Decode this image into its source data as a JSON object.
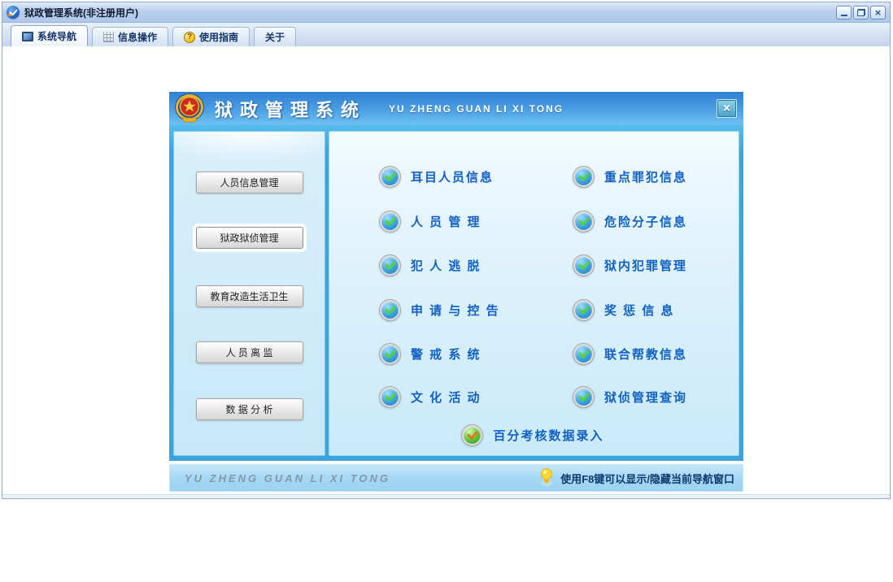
{
  "window": {
    "title": "狱政管理系统(非注册用户)",
    "controls": {
      "close_glyph": "×"
    }
  },
  "tabs": [
    {
      "label": "系统导航"
    },
    {
      "label": "信息操作"
    },
    {
      "label": "使用指南",
      "icon_glyph": "?"
    },
    {
      "label": "关于"
    }
  ],
  "dialog": {
    "title": "狱政管理系统",
    "subtitle": "YU ZHENG GUAN LI XI TONG",
    "close_glyph": "×",
    "sidebar": {
      "items": [
        {
          "label": "人员信息管理"
        },
        {
          "label": "狱政狱侦管理",
          "selected": true
        },
        {
          "label": "教育改造生活卫生"
        },
        {
          "label": "人 员 离 监"
        },
        {
          "label": "数 据 分 析"
        }
      ]
    },
    "menu": {
      "items": [
        {
          "label": "耳目人员信息"
        },
        {
          "label": "重点罪犯信息"
        },
        {
          "label": "人 员 管 理"
        },
        {
          "label": "危险分子信息"
        },
        {
          "label": "犯 人 逃 脱"
        },
        {
          "label": "狱内犯罪管理"
        },
        {
          "label": "申 请 与 控 告"
        },
        {
          "label": "奖 惩 信 息"
        },
        {
          "label": "警 戒 系 统"
        },
        {
          "label": "联合帮教信息"
        },
        {
          "label": "文 化 活 动"
        },
        {
          "label": "狱侦管理查询"
        }
      ],
      "bottom": {
        "label": "百分考核数据录入"
      }
    },
    "footer": {
      "brand": "YU ZHENG GUAN LI XI TONG",
      "tip": "使用F8键可以显示/隐藏当前导航窗口"
    }
  },
  "colors": {
    "header_blue": "#3f8fd8",
    "body_blue": "#3fa3db",
    "menu_text_blue": "#1161c4",
    "footer_band": "#a5d8f4"
  }
}
